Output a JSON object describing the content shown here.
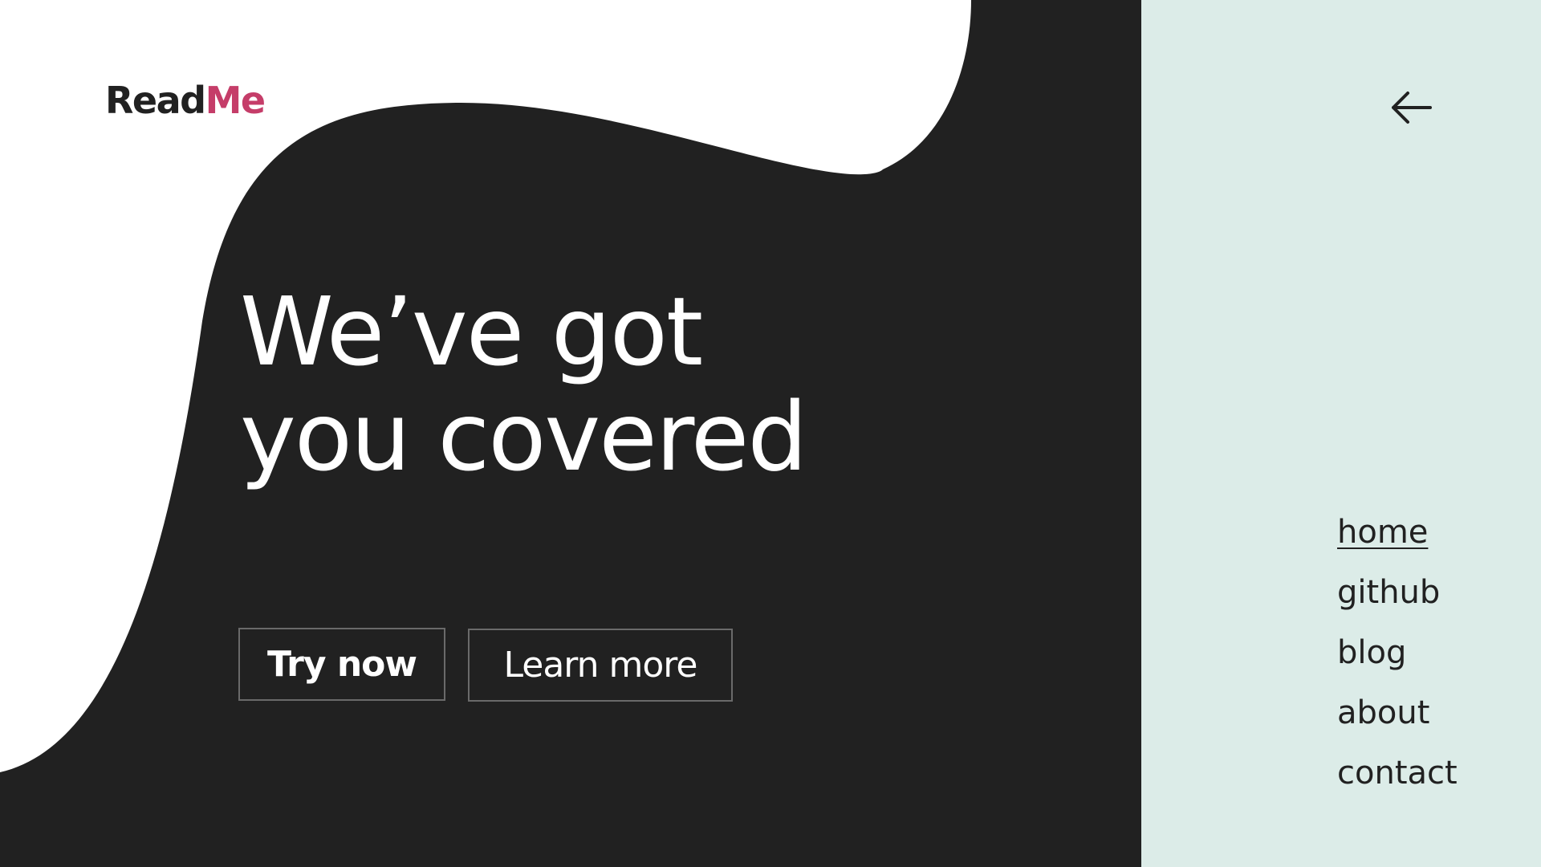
{
  "brand": {
    "part1": "Read",
    "part2": "Me",
    "part1_color": "#212121",
    "part2_color": "#c53d69"
  },
  "hero": {
    "headline_line1": "We’ve got",
    "headline_line2": "you covered",
    "background_color": "#212121",
    "text_color": "#ffffff"
  },
  "buttons": {
    "primary_label": "Try now",
    "secondary_label": "Learn more"
  },
  "side_panel": {
    "background_color": "#dcece8",
    "back_icon": "arrow-left-icon",
    "nav": [
      {
        "label": "home",
        "active": true
      },
      {
        "label": "github",
        "active": false
      },
      {
        "label": "blog",
        "active": false
      },
      {
        "label": "about",
        "active": false
      },
      {
        "label": "contact",
        "active": false
      }
    ]
  }
}
